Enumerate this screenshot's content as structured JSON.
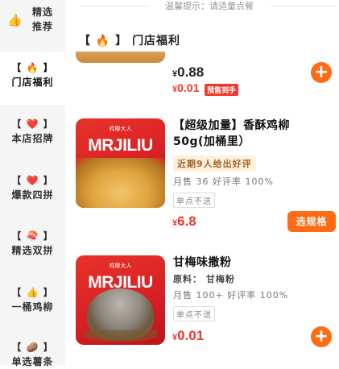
{
  "tip": "温馨提示：请适量点餐",
  "section_title": {
    "left_bracket": "【",
    "icon": "fire-icon",
    "fire": "🔥",
    "right_bracket": "】",
    "text": "门店福利"
  },
  "sidebar": [
    {
      "icon": "👍",
      "label1": "精选",
      "label2": "推荐",
      "active": false
    },
    {
      "icon": "🔥",
      "label2": "门店福利",
      "active": true
    },
    {
      "icon": "❤️",
      "label2": "本店招牌",
      "active": false
    },
    {
      "icon": "❤️",
      "label2": "爆款四拼",
      "active": false
    },
    {
      "icon": "🍣",
      "label2": "精选双拼",
      "active": false
    },
    {
      "icon": "👍",
      "label2": "一桶鸡柳",
      "active": false
    },
    {
      "icon": "🥔",
      "label2": "单选薯条",
      "active": false
    }
  ],
  "first_item": {
    "price_currency": "¥",
    "price_main": "0.88",
    "price2_currency": "¥",
    "price2": "0.01",
    "presale_badge": "预售到手"
  },
  "products": [
    {
      "brand": "鸡柳大人",
      "image_text": "MRJILIU",
      "title_line1": "【超级加量】香酥鸡柳",
      "title_line2": "50g(加桶里）",
      "promo": "近期9人给出好评",
      "meta": "月售 36 好评率 100%",
      "tag": "单点不送",
      "price_currency": "¥",
      "price": "6.8",
      "button": "选规格"
    },
    {
      "brand": "鸡柳大人",
      "image_text": "MRJILIU",
      "title": "甘梅味撒粉",
      "ingredient": "原料： 甘梅粉",
      "meta": "月售 100+ 好评率 100%",
      "tag": "单点不送",
      "price_currency": "¥",
      "price": "0.01",
      "button": "+"
    }
  ],
  "add_symbol": "+"
}
